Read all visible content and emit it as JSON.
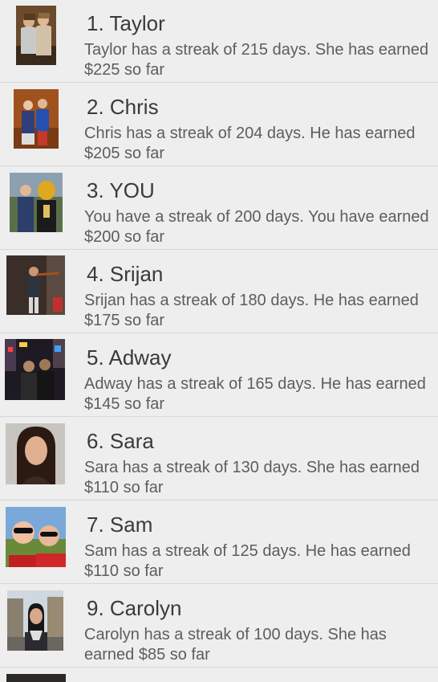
{
  "leaderboard": {
    "items": [
      {
        "name": "1. Taylor",
        "desc": "Taylor has a streak of 215 days. She has earned $225 so far",
        "thumb": "photo-two-people-icon"
      },
      {
        "name": "2. Chris",
        "desc": "Chris has a streak of 204 days. He has earned $205 so far",
        "thumb": "photo-couple-icon"
      },
      {
        "name": "3. YOU",
        "desc": "You have a streak of 200 days. You have earned $200 so far",
        "thumb": "photo-mascot-icon"
      },
      {
        "name": "4. Srijan",
        "desc": "Srijan has a streak of 180 days. He has earned $175 so far",
        "thumb": "photo-violinist-icon"
      },
      {
        "name": "5. Adway",
        "desc": "Adway has a streak of 165 days. He has earned $145 so far",
        "thumb": "photo-night-city-icon"
      },
      {
        "name": "6. Sara",
        "desc": "Sara has a streak of 130 days. She has earned $110 so far",
        "thumb": "photo-portrait-icon"
      },
      {
        "name": "7. Sam",
        "desc": "Sam has a streak of 125 days. He has earned $110 so far",
        "thumb": "photo-selfie-sunglasses-icon"
      },
      {
        "name": "9. Carolyn",
        "desc": "Carolyn has a streak of 100 days. She has earned $85 so far",
        "thumb": "photo-street-portrait-icon"
      }
    ]
  }
}
